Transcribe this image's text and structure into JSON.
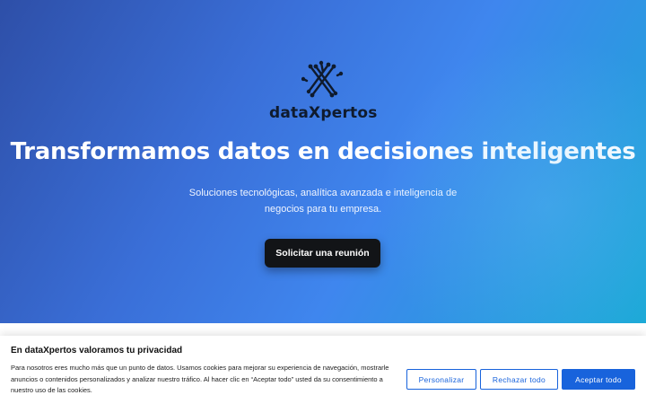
{
  "brand": {
    "name": "dataXpertos",
    "logo_icon": "circuit-x-icon"
  },
  "hero": {
    "headline": "Transformamos datos en decisiones inteligentes",
    "subtitle": "Soluciones tecnológicas, analítica avanzada e inteligencia de negocios para tu empresa.",
    "cta_label": "Solicitar una reunión"
  },
  "cookie_banner": {
    "title": "En dataXpertos valoramos tu privacidad",
    "text": "Para nosotros eres mucho más que un punto de datos. Usamos cookies para mejorar su experiencia de navegación, mostrarle anuncios o contenidos personalizados y analizar nuestro tráfico. Al hacer clic en “Aceptar todo” usted da su consentimiento a nuestro uso de las cookies.",
    "customize_label": "Personalizar",
    "reject_label": "Rechazar todo",
    "accept_label": "Aceptar todo"
  },
  "colors": {
    "accent": "#1863dc",
    "cta_bg": "#121417",
    "hero_gradient": [
      "#2e4fa8",
      "#3f86ee",
      "#1aa9d6"
    ]
  }
}
